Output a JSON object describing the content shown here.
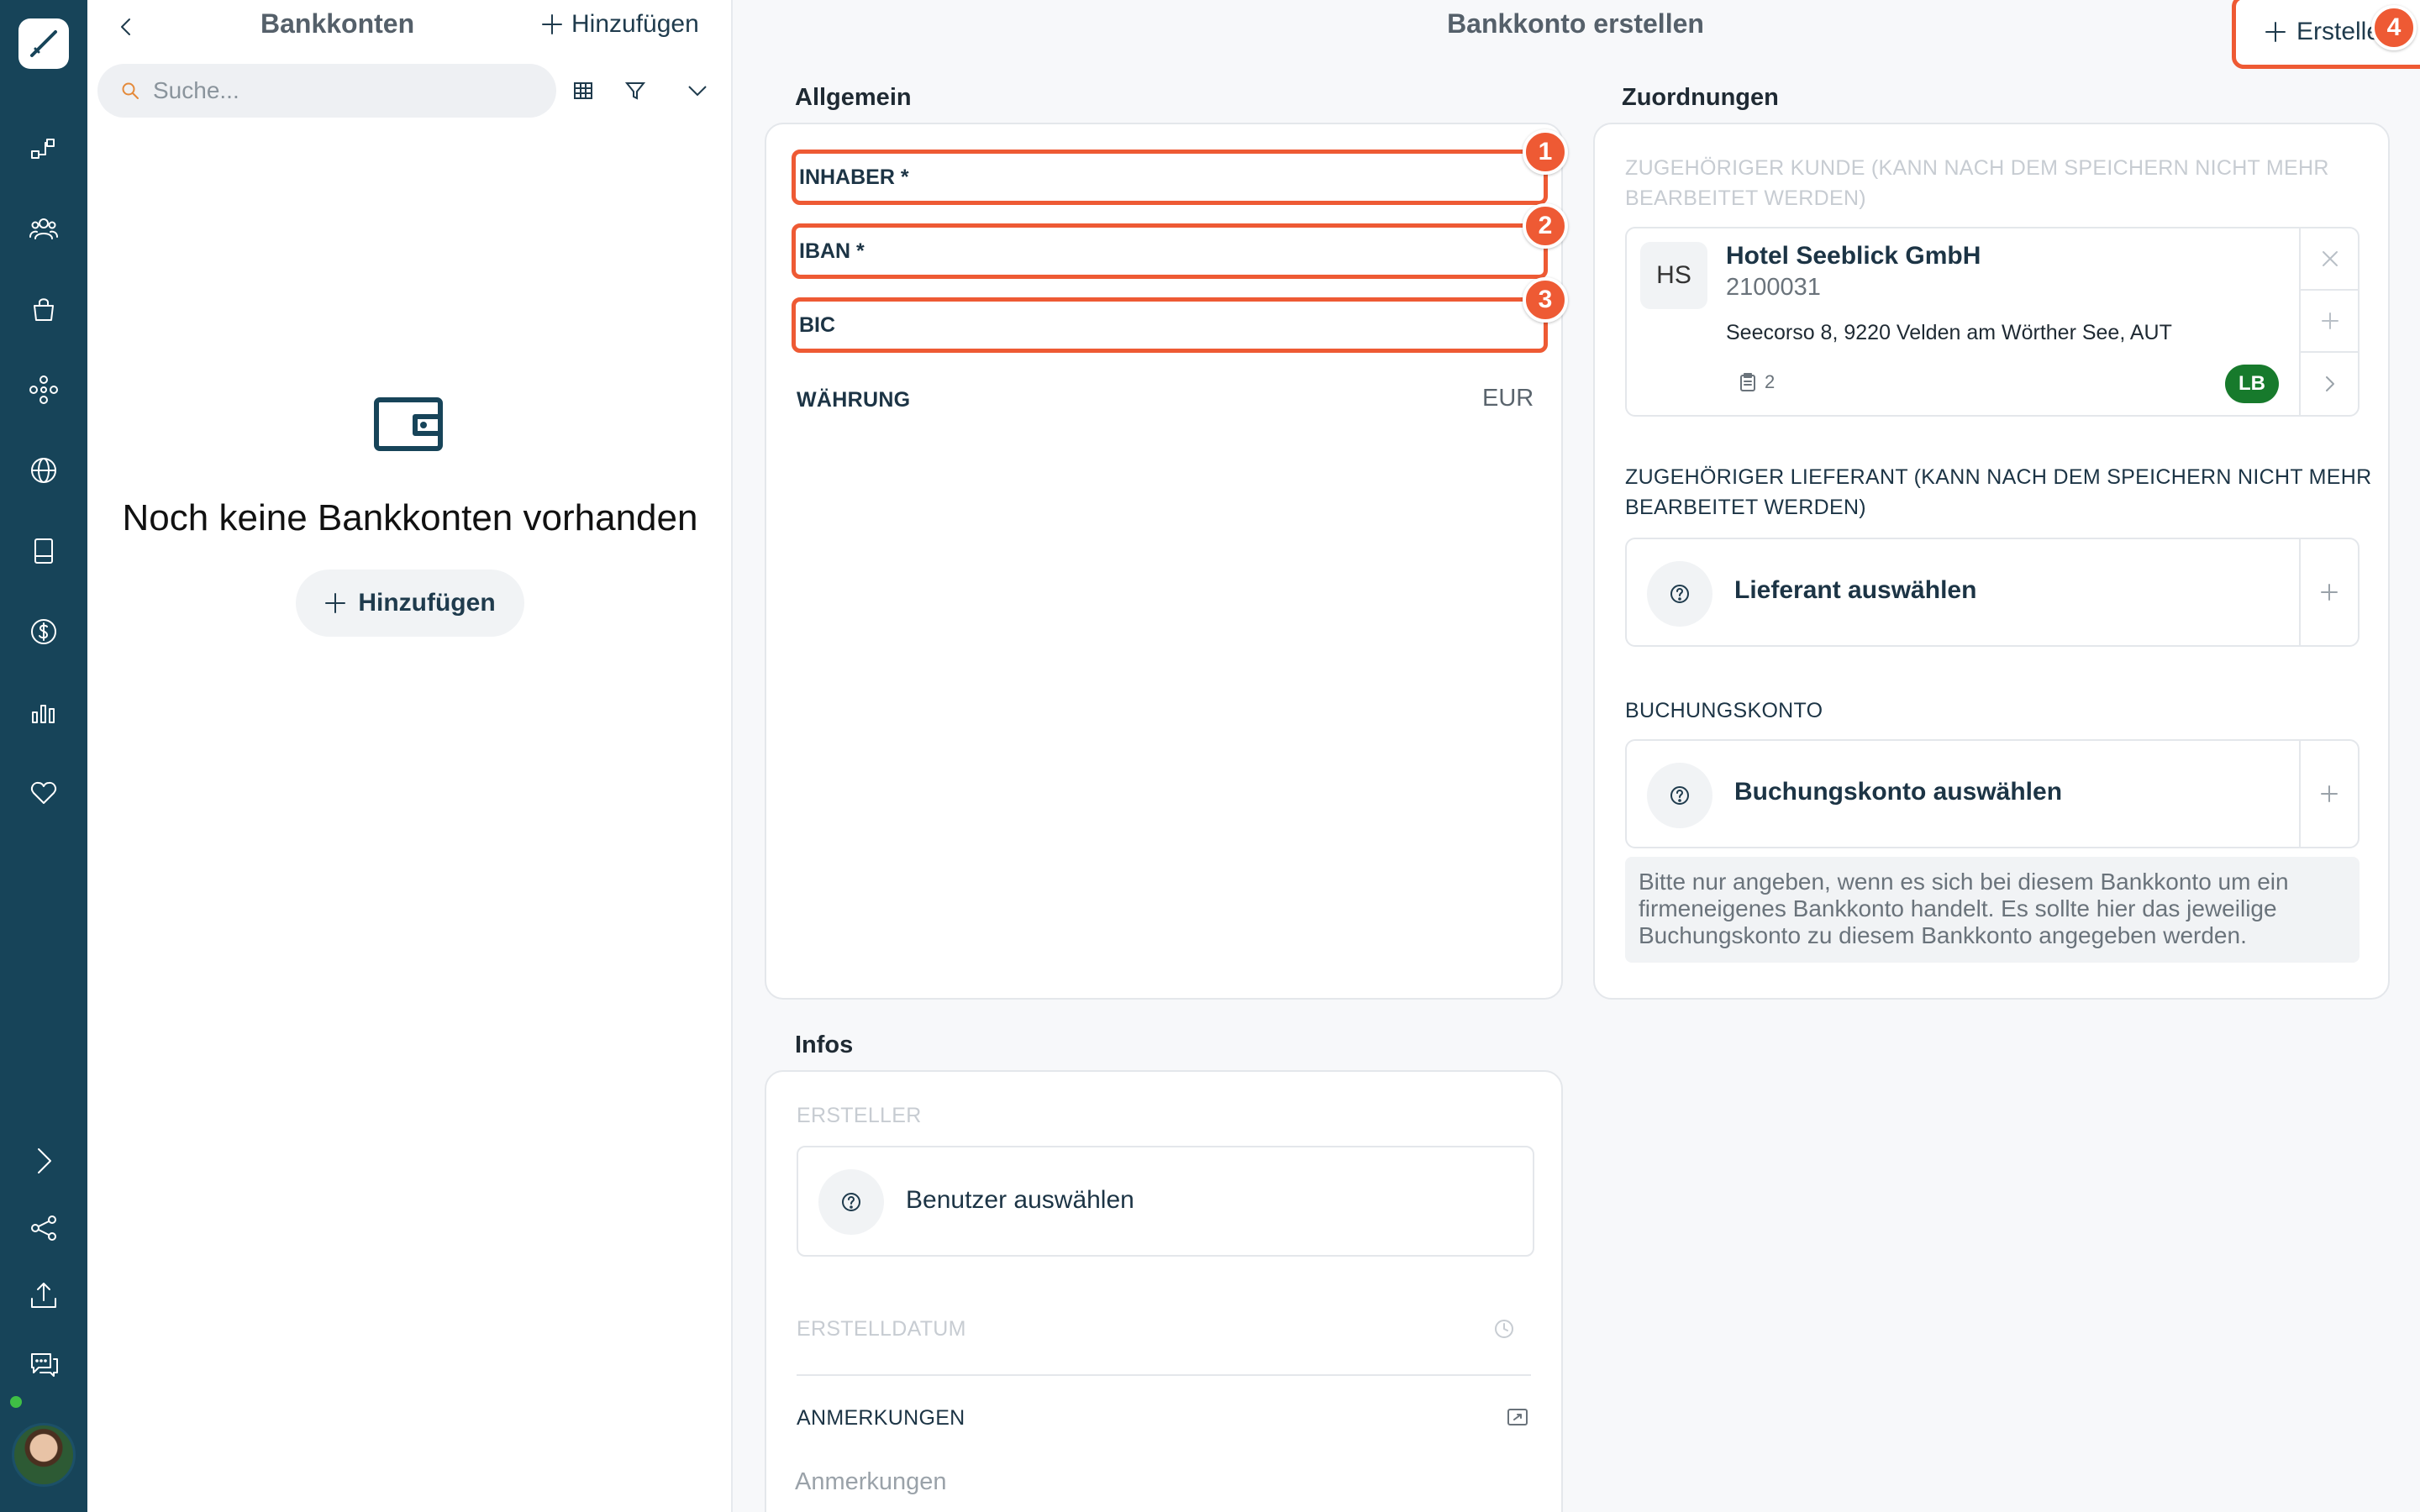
{
  "sidebar": {
    "icons": [
      "logo-icon",
      "workflow-icon",
      "contacts-icon",
      "shopping-bag-icon",
      "network-icon",
      "globe-icon",
      "book-icon",
      "dollar-icon",
      "bar-chart-icon",
      "heart-icon",
      "expand-icon",
      "share-icon",
      "upload-icon",
      "chat-icon"
    ]
  },
  "list_panel": {
    "title": "Bankkonten",
    "add_label": "Hinzufügen",
    "search_placeholder": "Suche...",
    "empty_title": "Noch keine Bankkonten vorhanden",
    "empty_add_label": "Hinzufügen"
  },
  "header": {
    "title": "Bankkonto erstellen",
    "create_label": "Erstellen"
  },
  "badges": [
    "1",
    "2",
    "3",
    "4"
  ],
  "general": {
    "section": "Allgemein",
    "owner_label": "INHABER *",
    "iban_label": "IBAN *",
    "bic_label": "BIC",
    "currency_label": "WÄHRUNG",
    "currency_value": "EUR"
  },
  "assignments": {
    "section": "Zuordnungen",
    "customer_label_line1": "ZUGEHÖRIGER KUNDE (KANN NACH DEM SPEICHERN NICHT MEHR",
    "customer_label_line2": "BEARBEITET WERDEN)",
    "customer": {
      "initials": "HS",
      "name": "Hotel Seeblick GmbH",
      "number": "2100031",
      "address": "Seecorso 8, 9220 Velden am Wörther See, AUT",
      "docs_count": "2",
      "owner_badge": "LB"
    },
    "supplier_label_line1": "ZUGEHÖRIGER LIEFERANT (KANN NACH DEM SPEICHERN NICHT MEHR",
    "supplier_label_line2": "BEARBEITET WERDEN)",
    "supplier_pick": "Lieferant auswählen",
    "booking_label": "BUCHUNGSKONTO",
    "booking_pick": "Buchungskonto auswählen",
    "booking_hint": "Bitte nur angeben, wenn es sich bei diesem Bankkonto um ein firmeneigenes Bankkonto handelt. Es sollte hier das jeweilige Buchungskonto zu diesem Bankkonto angegeben werden."
  },
  "infos": {
    "section": "Infos",
    "creator_label": "ERSTELLER",
    "creator_pick": "Benutzer auswählen",
    "created_date_label": "ERSTELLDATUM",
    "notes_label": "ANMERKUNGEN",
    "notes_placeholder": "Anmerkungen"
  },
  "colors": {
    "rail": "#174459",
    "highlight": "#ee5a34",
    "owner_badge": "#177a2c"
  }
}
